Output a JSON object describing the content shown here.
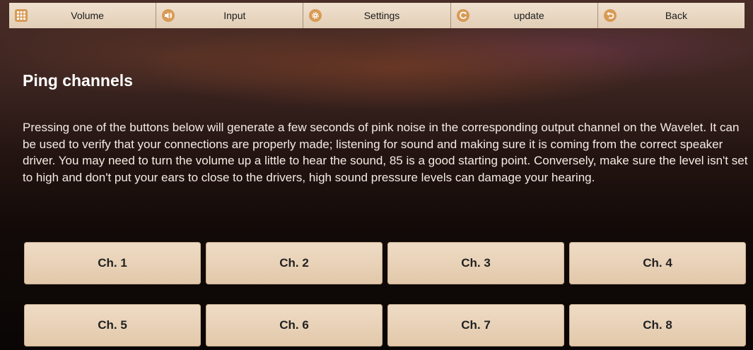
{
  "toolbar": {
    "items": [
      {
        "label": "Volume",
        "icon": "grid-icon"
      },
      {
        "label": "Input",
        "icon": "speaker-icon"
      },
      {
        "label": "Settings",
        "icon": "gear-icon"
      },
      {
        "label": "update",
        "icon": "refresh-icon"
      },
      {
        "label": "Back",
        "icon": "back-arrow-icon"
      }
    ],
    "accent_color": "#d89a55"
  },
  "main": {
    "title": "Ping channels",
    "description": "Pressing one of the buttons below will generate a few seconds of pink noise in the corresponding output channel on the Wavelet. It can be used to verify that your connections are properly made; listening for sound and making sure it is coming from the correct speaker driver. You may need to turn the volume up a little to hear the sound, 85 is a good starting point. Conversely, make sure the level isn't set to high and don't put your ears to close to the drivers, high sound pressure levels can damage your hearing.",
    "channels": [
      "Ch. 1",
      "Ch. 2",
      "Ch. 3",
      "Ch. 4",
      "Ch. 5",
      "Ch. 6",
      "Ch. 7",
      "Ch. 8"
    ]
  }
}
